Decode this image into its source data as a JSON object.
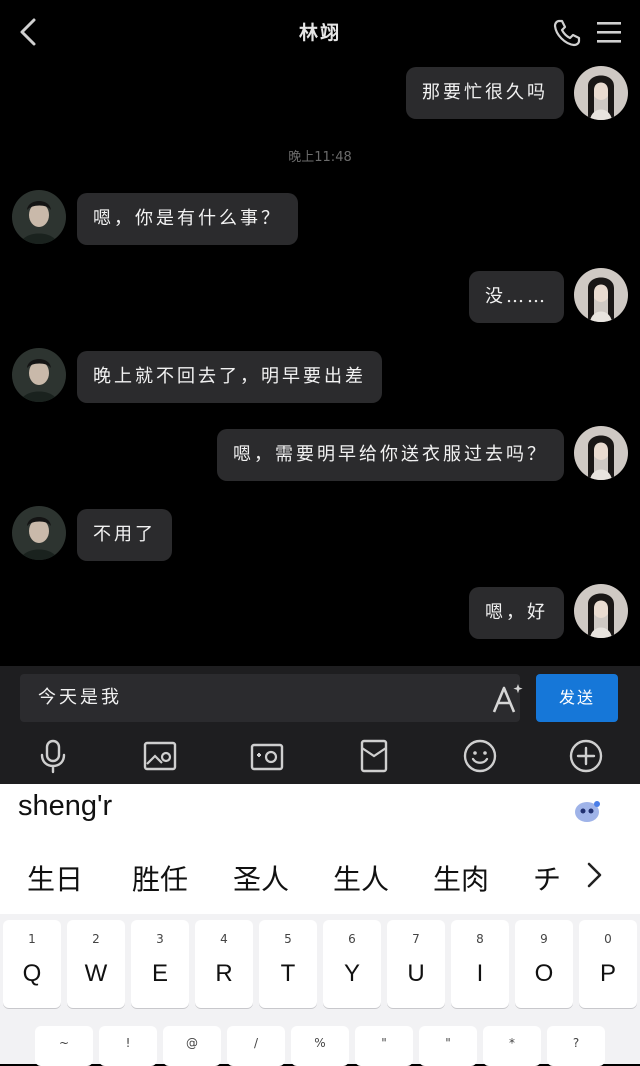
{
  "header": {
    "title": "林翊"
  },
  "messages": [
    {
      "side": "right",
      "text": "那要忙很久吗"
    },
    {
      "side": "left",
      "text": "嗯，你是有什么事？"
    },
    {
      "side": "right",
      "text": "没……"
    },
    {
      "side": "left",
      "text": "晚上就不回去了，明早要出差"
    },
    {
      "side": "right",
      "text": "嗯，需要明早给你送衣服过去吗？"
    },
    {
      "side": "left",
      "text": "不用了"
    },
    {
      "side": "right",
      "text": "嗯，好"
    }
  ],
  "timestamp": "晚上11:48",
  "input": {
    "value": "今天是我",
    "send_label": "发送"
  },
  "toolbar": [
    "microphone-icon",
    "image-icon",
    "camera-icon",
    "red-packet-icon",
    "emoji-icon",
    "plus-icon"
  ],
  "ime": {
    "pinyin": "sheng'r",
    "candidates": [
      "生日",
      "胜任",
      "圣人",
      "生人",
      "生肉",
      "チ"
    ],
    "number_row": [
      "1",
      "2",
      "3",
      "4",
      "5",
      "6",
      "7",
      "8",
      "9",
      "0"
    ],
    "letter_row": [
      "Q",
      "W",
      "E",
      "R",
      "T",
      "Y",
      "U",
      "I",
      "O",
      "P"
    ],
    "symbol_row": [
      "~",
      "!",
      "@",
      "/",
      "%",
      "\"",
      "\"",
      "*",
      "?"
    ]
  },
  "colors": {
    "send_button": "#1677d8",
    "bubble": "#2b2b2d",
    "background": "#000000"
  }
}
